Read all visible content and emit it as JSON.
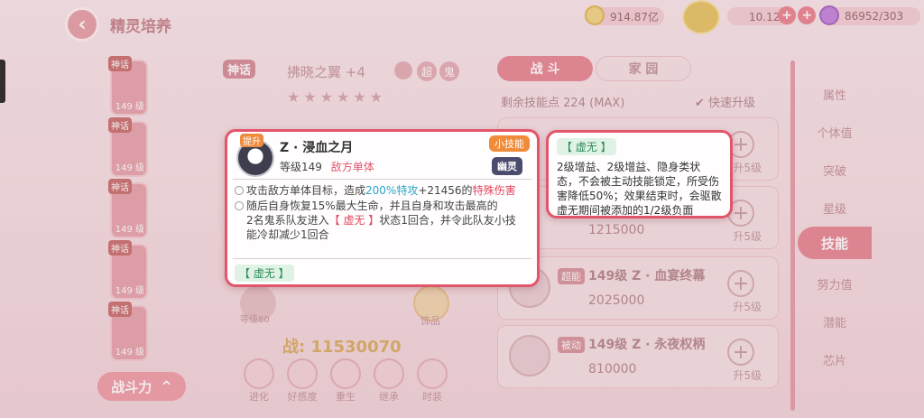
{
  "header": {
    "title": "精灵培养",
    "back_glyph": "‹",
    "resources": [
      {
        "name": "gold",
        "value": "914.87亿"
      },
      {
        "name": "diamond",
        "value": "10.12亿"
      },
      {
        "name": "energy",
        "value": "86952/303"
      }
    ]
  },
  "pets": [
    {
      "tag": "神话",
      "level": "149 级"
    },
    {
      "tag": "神话",
      "level": "149 级"
    },
    {
      "tag": "神话",
      "level": "149 级"
    },
    {
      "tag": "神话",
      "level": "149 级"
    },
    {
      "tag": "神话",
      "level": "149 级"
    }
  ],
  "combat_toggle": {
    "label": "战斗力",
    "chevron": "^"
  },
  "center": {
    "tag": "神话",
    "pet_name": "拂晓之翼 +4",
    "badge_chao": "超",
    "badge_gui": "鬼",
    "combat_power": "战: 11530070",
    "grade": "等级80",
    "accessory": "饰品",
    "actions": [
      "进化",
      "好感度",
      "重生",
      "继承",
      "时装"
    ]
  },
  "tabs": {
    "battle": "战 斗",
    "home": "家 园"
  },
  "skill_points": {
    "label": "剩余技能点",
    "value": "224",
    "max": "(MAX)"
  },
  "fast_upgrade": "快速升级",
  "skills": [
    {
      "badge": "",
      "title": "",
      "cost": "",
      "upgrade": "升5级"
    },
    {
      "badge": "",
      "title": "",
      "cost": "1215000",
      "upgrade": "升5级"
    },
    {
      "badge": "超能",
      "title": "149级 Z · 血宴终幕",
      "cost": "2025000",
      "upgrade": "升5级"
    },
    {
      "badge": "被动",
      "title": "149级 Z · 永夜权柄",
      "cost": "810000",
      "upgrade": "升5级"
    }
  ],
  "side_menu": [
    "属性",
    "个体值",
    "突破",
    "星级",
    "技能",
    "努力值",
    "潜能",
    "芯片"
  ],
  "side_active": "技能",
  "popup": {
    "badge_up": "提升",
    "name": "Z · 浸血之月",
    "level": "等级149",
    "target": "敌方单体",
    "type_small": "小技能",
    "type_ghost": "幽灵",
    "line1_a": "攻击敌方单体目标，造成",
    "line1_b": "200%特攻",
    "line1_c": "+21456的",
    "line1_d": "特殊伤害",
    "line2_a": "随后自身恢复15%最大生命，并且自身和攻击最高的",
    "line3_a": "2名鬼系队友进入",
    "line3_b": "【 虚无 】",
    "line3_c": "状态1回合，并令此队友小技",
    "line4": "能冷却减少1回合",
    "link": "【 虚无 】"
  },
  "popup2": {
    "title": "【 虚无 】",
    "desc": "2级增益、2级增益、隐身类状态，不会被主动技能锁定，所受伤害降低50%；效果结束时，会驱散虚无期间被添加的1/2级负面"
  },
  "colors": {
    "accent": "#e2566b",
    "highlight_blue": "#2aa6c8",
    "status_green": "#2d8c55",
    "small_skill": "#f08b3a",
    "ghost_type": "#4b4c6d"
  }
}
